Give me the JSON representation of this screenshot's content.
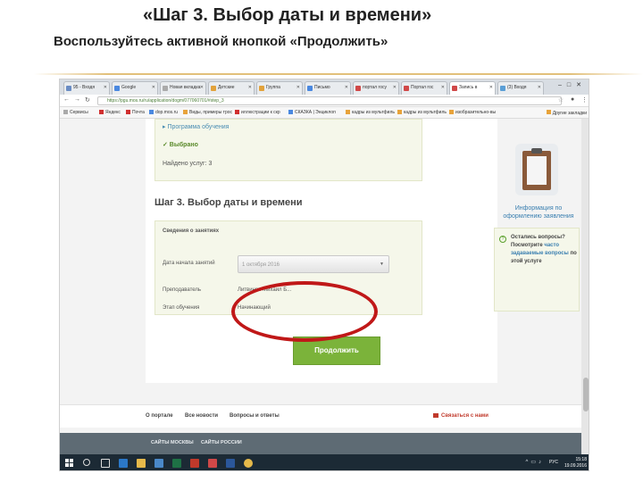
{
  "slide": {
    "bullet_glyph": "",
    "title": "«Шаг 3. Выбор даты и времени»",
    "subtitle": "Воспользуйтесь активной кнопкой «Продолжить»",
    "accent_color": "#d9a441"
  },
  "browser": {
    "tabs": [
      {
        "label": "95 - Входя"
      },
      {
        "label": "Google"
      },
      {
        "label": "Новая вкладка"
      },
      {
        "label": "Детские"
      },
      {
        "label": "Группа"
      },
      {
        "label": "Письмо"
      },
      {
        "label": "портал госу"
      },
      {
        "label": "Портал гос"
      },
      {
        "label": "Запись в"
      },
      {
        "label": "(3) Входя"
      }
    ],
    "url": "https://pgu.mos.ru/ru/application/dogm/077060701/#step_3",
    "bookmarks": [
      {
        "label": "Сервисы"
      },
      {
        "label": "Яндекс"
      },
      {
        "label": "Почта"
      },
      {
        "label": "dop.mos.ru"
      },
      {
        "label": "Виды, примеры трос"
      },
      {
        "label": "иллюстрации к скр"
      },
      {
        "label": "СКАЗКА | Энциклоп"
      },
      {
        "label": "кадры из мультфиль"
      },
      {
        "label": "кадры из мультфиль"
      },
      {
        "label": "изобразительно-вы"
      }
    ],
    "bookmarks_more": "Другие закладки"
  },
  "page": {
    "program_link": "▸ Программа обучения",
    "chosen": "✓ Выбрано",
    "found_services": "Найдено услуг: 3",
    "step_heading": "Шаг 3. Выбор даты и времени",
    "section_title": "Сведения о занятиях",
    "start_date_label": "Дата начала занятий",
    "start_date_value": "1 октября 2016",
    "teacher_label": "Преподаватель",
    "teacher_value": "Литвинов Михаил Б...",
    "stage_label": "Этап обучения",
    "stage_value": "Начинающий",
    "continue_button": "Продолжить",
    "side_info_link": "Информация по оформлению заявления",
    "question_text_1": "Остались вопросы? Посмотрите",
    "question_link": "часто задаваемые вопросы",
    "question_text_2": "по этой услуге"
  },
  "footer": {
    "links": [
      "О портале",
      "Все новости",
      "Вопросы и ответы"
    ],
    "contact": "Связаться с нами",
    "bottom_links": [
      "САЙТЫ МОСКВЫ",
      "САЙТЫ РОССИИ"
    ]
  },
  "taskbar": {
    "lang": "РУС",
    "time": "15:18",
    "date": "19.09.2016"
  },
  "colors": {
    "button_green": "#7bb33a",
    "highlight_oval": "#c01818",
    "link_blue": "#3a7fb0"
  }
}
